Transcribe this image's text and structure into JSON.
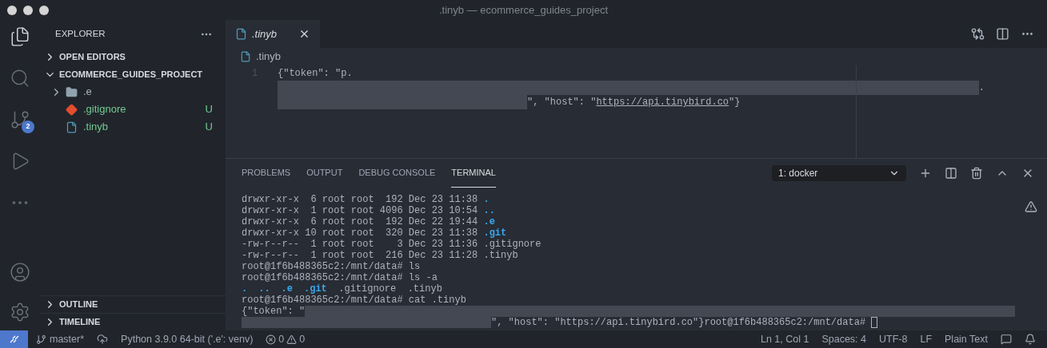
{
  "window": {
    "title": ".tinyb — ecommerce_guides_project"
  },
  "activity_bar": {
    "items": [
      {
        "kind": "files",
        "selected": true
      },
      {
        "kind": "search",
        "selected": false
      },
      {
        "kind": "source_control",
        "selected": false,
        "badge": "2"
      },
      {
        "kind": "run",
        "selected": false
      },
      {
        "kind": "more",
        "selected": false
      }
    ],
    "bottom": [
      {
        "kind": "account"
      },
      {
        "kind": "settings"
      }
    ]
  },
  "sidebar": {
    "title": "EXPLORER",
    "sections": [
      {
        "label": "OPEN EDITORS",
        "expanded": false
      },
      {
        "label": "ECOMMERCE_GUIDES_PROJECT",
        "expanded": true,
        "children": [
          {
            "kind": "folder",
            "label": ".e",
            "expanded": false,
            "untracked": false
          },
          {
            "kind": "gitignore",
            "label": ".gitignore",
            "untracked": true,
            "status": "U"
          },
          {
            "kind": "file",
            "label": ".tinyb",
            "untracked": true,
            "status": "U"
          }
        ]
      }
    ],
    "bottom_sections": [
      {
        "label": "OUTLINE",
        "expanded": false
      },
      {
        "label": "TIMELINE",
        "expanded": false
      }
    ]
  },
  "tabs": [
    {
      "label": ".tinyb",
      "selected": true,
      "preview": true
    }
  ],
  "breadcrumb": ".tinyb",
  "editor": {
    "line_number": "1",
    "rows": [
      {
        "segments": [
          {
            "kind": "text",
            "text": "{\"token\": \"p."
          }
        ]
      },
      {
        "segments": [
          {
            "kind": "redaction"
          },
          {
            "kind": "text",
            "text": "."
          }
        ]
      },
      {
        "segments": [
          {
            "kind": "redaction_short"
          },
          {
            "kind": "text",
            "text": "\", \"host\": \""
          },
          {
            "kind": "link",
            "text": "https://api.tinybird.co"
          },
          {
            "kind": "text",
            "text": "\"}"
          }
        ]
      }
    ]
  },
  "panel": {
    "tabs": [
      {
        "label": "PROBLEMS",
        "selected": false
      },
      {
        "label": "OUTPUT",
        "selected": false
      },
      {
        "label": "DEBUG CONSOLE",
        "selected": false
      },
      {
        "label": "TERMINAL",
        "selected": true
      }
    ],
    "terminal_select": "1: docker",
    "terminal": [
      {
        "segments": [
          {
            "kind": "text",
            "text": "drwxr-xr-x  6 root root  192 Dec 23 11:38 "
          },
          {
            "kind": "dir",
            "text": "."
          }
        ]
      },
      {
        "segments": [
          {
            "kind": "text",
            "text": "drwxr-xr-x  1 root root 4096 Dec 23 10:54 "
          },
          {
            "kind": "dir",
            "text": ".."
          }
        ]
      },
      {
        "segments": [
          {
            "kind": "text",
            "text": "drwxr-xr-x  6 root root  192 Dec 22 19:44 "
          },
          {
            "kind": "dir",
            "text": ".e"
          }
        ]
      },
      {
        "segments": [
          {
            "kind": "text",
            "text": "drwxr-xr-x 10 root root  320 Dec 23 11:38 "
          },
          {
            "kind": "dir",
            "text": ".git"
          }
        ]
      },
      {
        "segments": [
          {
            "kind": "text",
            "text": "-rw-r--r--  1 root root    3 Dec 23 11:36 .gitignore"
          }
        ]
      },
      {
        "segments": [
          {
            "kind": "text",
            "text": "-rw-r--r--  1 root root  216 Dec 23 11:28 .tinyb"
          }
        ]
      },
      {
        "segments": [
          {
            "kind": "text",
            "text": "root@1f6b488365c2:/mnt/data# ls"
          }
        ]
      },
      {
        "segments": [
          {
            "kind": "text",
            "text": "root@1f6b488365c2:/mnt/data# ls -a"
          }
        ]
      },
      {
        "segments": [
          {
            "kind": "dir",
            "text": "."
          },
          {
            "kind": "gap"
          },
          {
            "kind": "dir",
            "text": ".."
          },
          {
            "kind": "gap"
          },
          {
            "kind": "dir",
            "text": ".e"
          },
          {
            "kind": "gap"
          },
          {
            "kind": "dir",
            "text": ".git"
          },
          {
            "kind": "text",
            "text": "  .gitignore  .tinyb"
          }
        ]
      },
      {
        "segments": [
          {
            "kind": "text",
            "text": "root@1f6b488365c2:/mnt/data# cat .tinyb"
          }
        ]
      },
      {
        "segments": [
          {
            "kind": "text",
            "text": "{\"token\": \""
          },
          {
            "kind": "redaction"
          }
        ]
      },
      {
        "segments": [
          {
            "kind": "redaction_short"
          },
          {
            "kind": "text",
            "text": "\", \"host\": \"https://api.tinybird.co\"}root@1f6b488365c2:/mnt/data# "
          },
          {
            "kind": "cursor"
          }
        ]
      }
    ]
  },
  "status_bar": {
    "branch": "master*",
    "interpreter": "Python 3.9.0 64-bit ('.e': venv)",
    "errors": "0",
    "warnings": "0",
    "right": [
      "Ln 1, Col 1",
      "Spaces: 4",
      "UTF-8",
      "LF",
      "Plain Text"
    ]
  }
}
